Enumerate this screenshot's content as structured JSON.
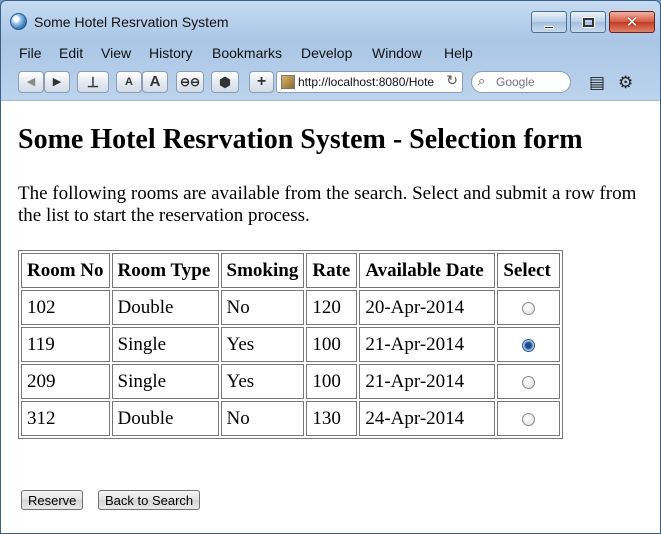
{
  "window": {
    "title": "Some Hotel Resrvation System"
  },
  "menu": [
    "File",
    "Edit",
    "View",
    "History",
    "Bookmarks",
    "Develop",
    "Window",
    "Help"
  ],
  "toolbar": {
    "address": "http://localhost:8080/Hote",
    "search_placeholder": "Google",
    "text_small": "A",
    "text_large": "A"
  },
  "page": {
    "heading": "Some Hotel Resrvation System - Selection form",
    "intro": "The following rooms are available from the search. Select and submit a row from the list to start the reservation process.",
    "columns": [
      "Room No",
      "Room Type",
      "Smoking",
      "Rate",
      "Available Date",
      "Select"
    ],
    "rows": [
      {
        "room": "102",
        "type": "Double",
        "smoking": "No",
        "rate": "120",
        "date": "20-Apr-2014",
        "selected": false
      },
      {
        "room": "119",
        "type": "Single",
        "smoking": "Yes",
        "rate": "100",
        "date": "21-Apr-2014",
        "selected": true
      },
      {
        "room": "209",
        "type": "Single",
        "smoking": "Yes",
        "rate": "100",
        "date": "21-Apr-2014",
        "selected": false
      },
      {
        "room": "312",
        "type": "Double",
        "smoking": "No",
        "rate": "130",
        "date": "24-Apr-2014",
        "selected": false
      }
    ],
    "reserve_label": "Reserve",
    "back_label": "Back to Search"
  }
}
